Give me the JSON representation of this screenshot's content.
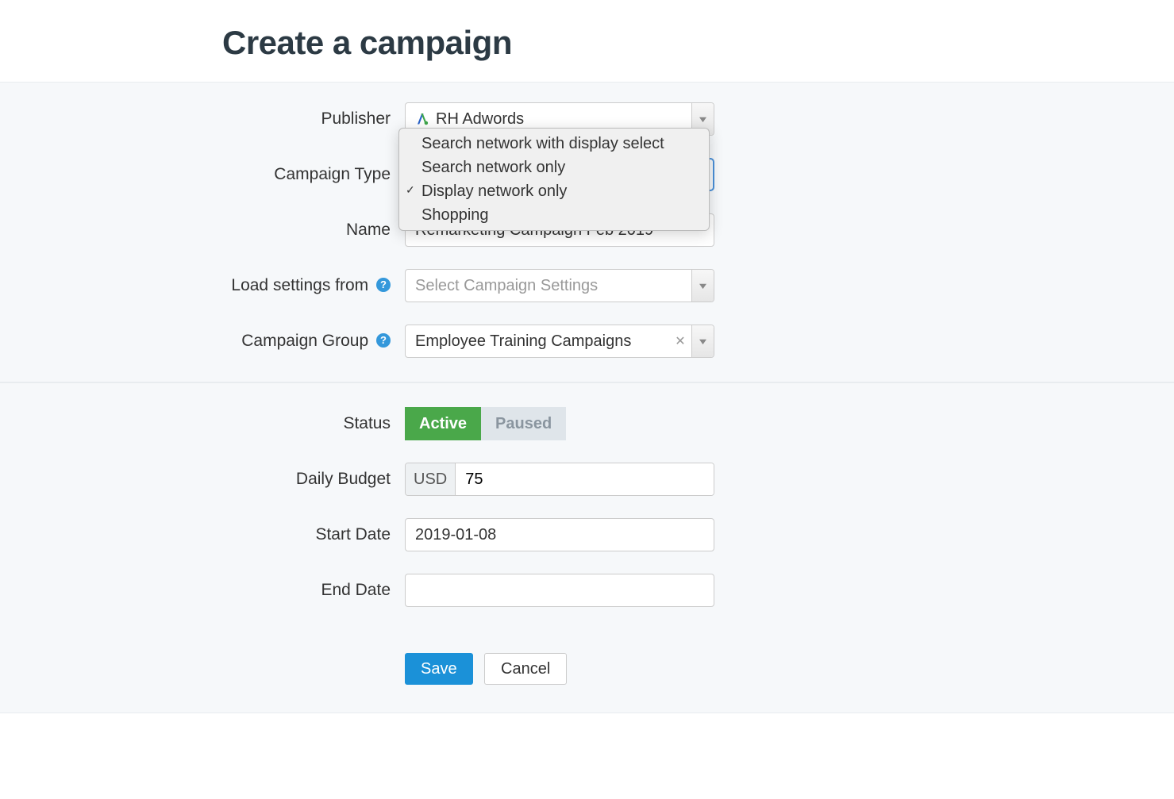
{
  "header": {
    "title": "Create a campaign"
  },
  "labels": {
    "publisher": "Publisher",
    "campaign_type": "Campaign Type",
    "name": "Name",
    "load_settings_from": "Load settings from",
    "campaign_group": "Campaign Group",
    "status": "Status",
    "daily_budget": "Daily Budget",
    "start_date": "Start Date",
    "end_date": "End Date"
  },
  "fields": {
    "publisher": {
      "value": "RH Adwords"
    },
    "campaign_type": {
      "options": [
        "Search network with display select",
        "Search network only",
        "Display network only",
        "Shopping"
      ],
      "selected_index": 2
    },
    "name": {
      "value": "Remarketing Campaign Feb 2019"
    },
    "load_settings_from": {
      "placeholder": "Select Campaign Settings"
    },
    "campaign_group": {
      "value": "Employee Training Campaigns"
    },
    "status": {
      "active_label": "Active",
      "paused_label": "Paused"
    },
    "daily_budget": {
      "currency": "USD",
      "value": "75"
    },
    "start_date": {
      "value": "2019-01-08"
    },
    "end_date": {
      "value": ""
    }
  },
  "actions": {
    "save": "Save",
    "cancel": "Cancel"
  },
  "icons": {
    "help": "?"
  }
}
